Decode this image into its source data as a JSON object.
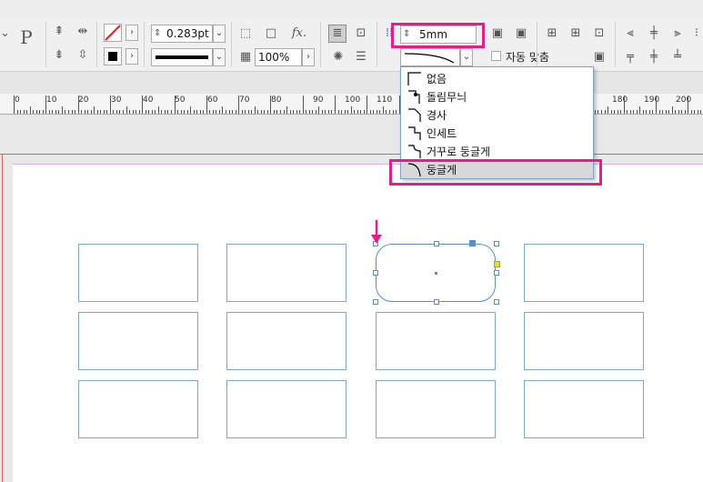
{
  "toolbar": {
    "stroke_weight": "0.283pt",
    "opacity": "100%",
    "corner_size": "5mm",
    "auto_fit_label": "자동 맞춤",
    "fx_label": "fx.",
    "reference_point_label": "P"
  },
  "ruler": {
    "labels": [
      "0",
      "10",
      "20",
      "30",
      "40",
      "50",
      "60",
      "70",
      "80",
      "90",
      "100",
      "110",
      "180",
      "190",
      "200"
    ]
  },
  "corner_menu": {
    "items": [
      {
        "label": "없음",
        "icon": "corner-none-icon"
      },
      {
        "label": "돌림무늬",
        "icon": "corner-fancy-icon"
      },
      {
        "label": "경사",
        "icon": "corner-bevel-icon"
      },
      {
        "label": "인세트",
        "icon": "corner-inset-icon"
      },
      {
        "label": "거꾸로 둥글게",
        "icon": "corner-inverse-rounded-icon"
      },
      {
        "label": "둥글게",
        "icon": "corner-rounded-icon",
        "selected": true
      }
    ]
  },
  "colors": {
    "highlight": "#e0218a",
    "frame_stroke": "#7aa8cf",
    "selection": "#5a8fc8",
    "bleed": "#e06060"
  },
  "canvas": {
    "grid_rows": 3,
    "grid_cols": 4,
    "selected_frame": "row-1-col-3",
    "selected_corner": "rounded"
  }
}
